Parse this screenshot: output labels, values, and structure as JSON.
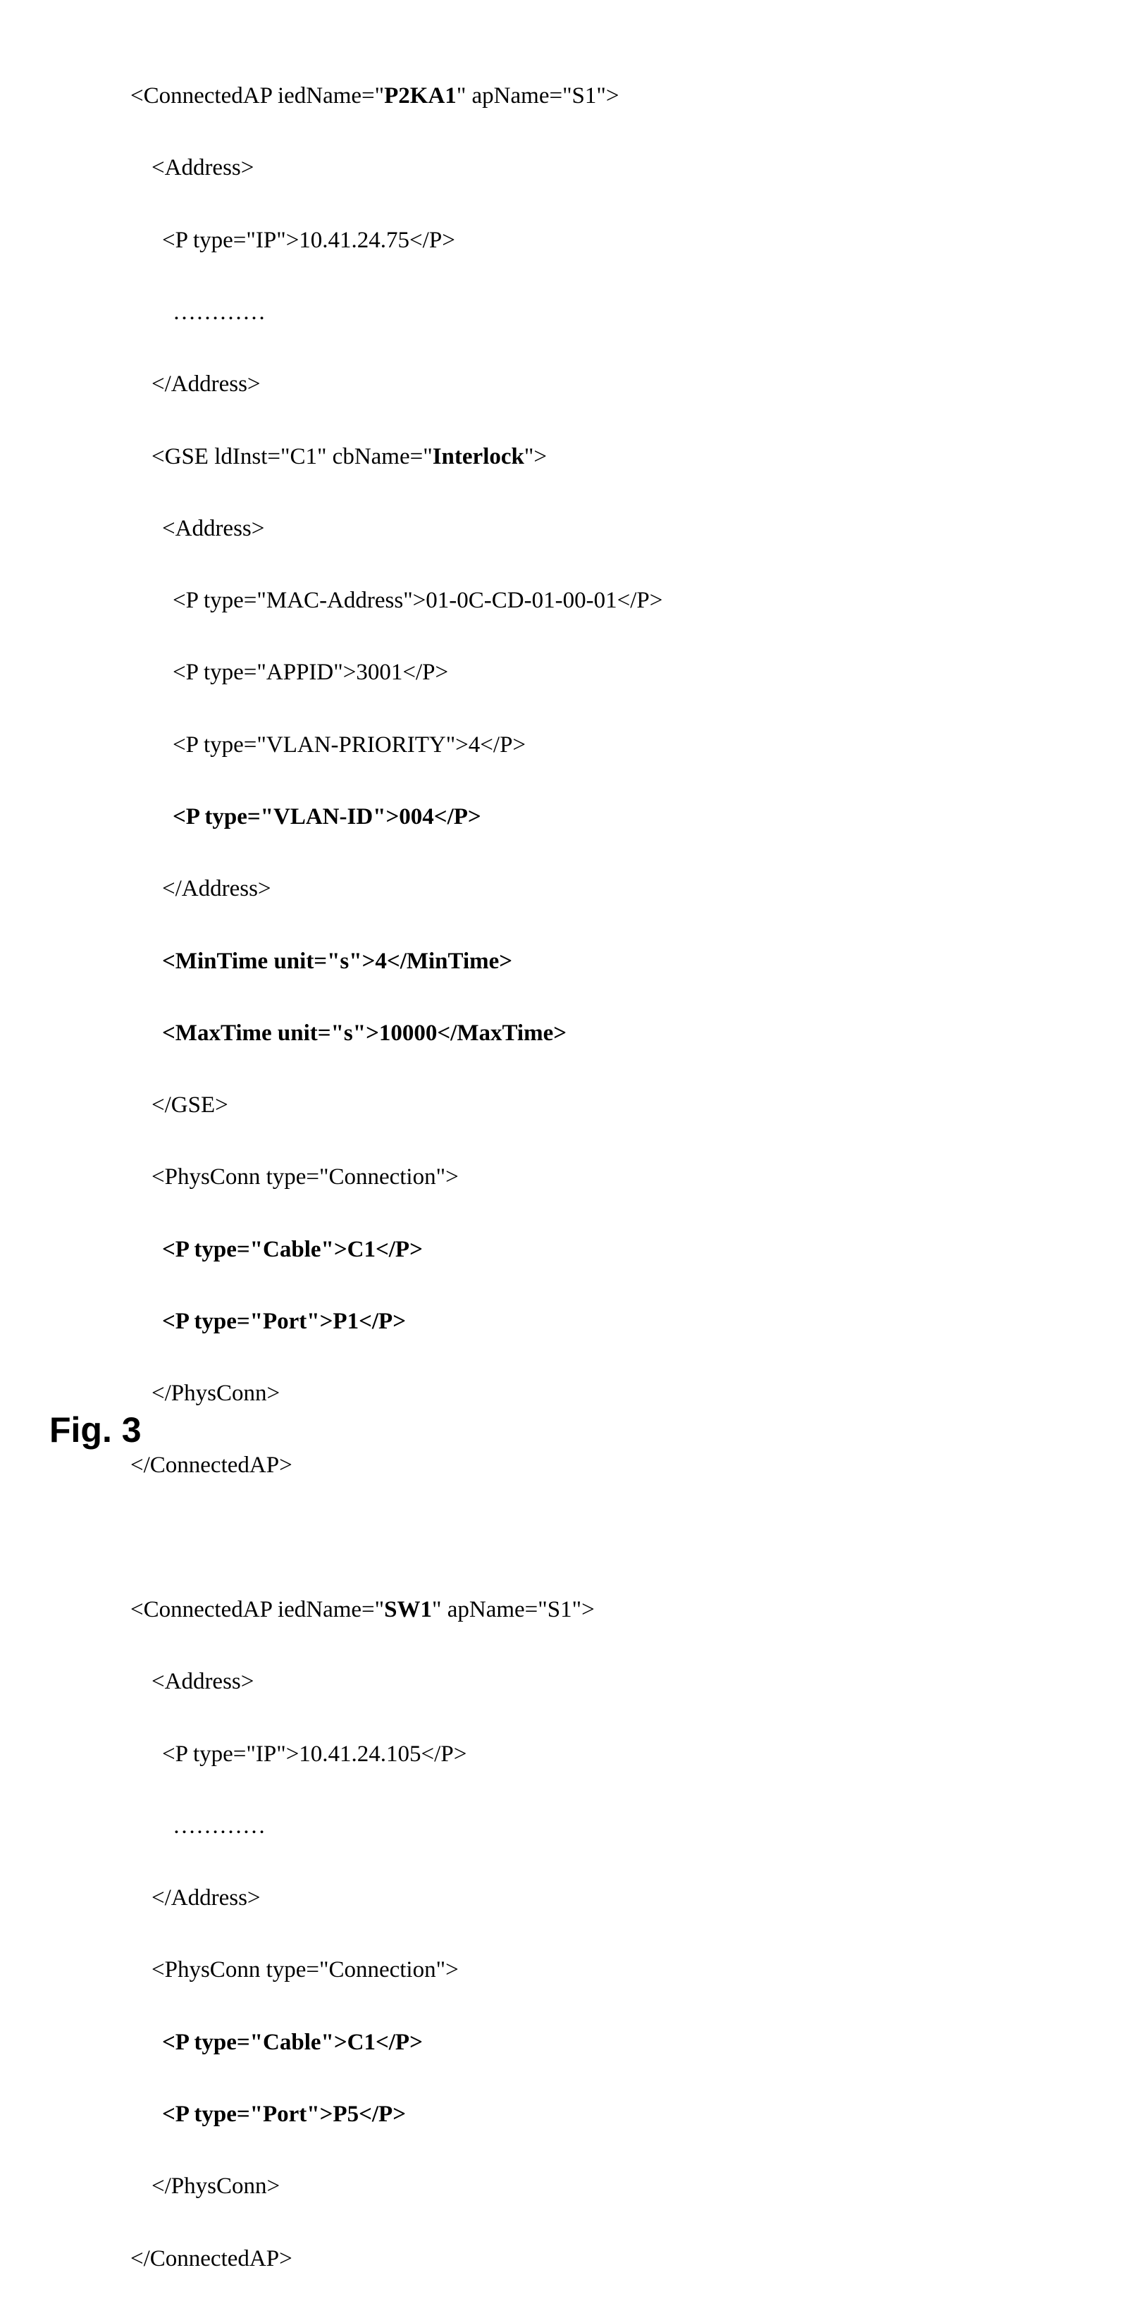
{
  "block1": {
    "line1_pre": "<ConnectedAP iedName=\"",
    "line1_bold": "P2KA1",
    "line1_post": "\" apName=\"S1\">",
    "line2": "<Address>",
    "line3": "<P type=\"IP\">10.41.24.75</P>",
    "dots": "…………",
    "line4": "</Address>",
    "line5_pre": "<GSE ldInst=\"C1\" cbName=\"",
    "line5_bold": "Interlock",
    "line5_post": "\">",
    "line6": "<Address>",
    "line7": "<P type=\"MAC-Address\">01-0C-CD-01-00-01</P>",
    "line8": "<P type=\"APPID\">3001</P>",
    "line9": "<P type=\"VLAN-PRIORITY\">4</P>",
    "line10": "<P type=\"VLAN-ID\">004</P>",
    "line11": "</Address>",
    "line12": "<MinTime unit=\"s\">4</MinTime>",
    "line13": "<MaxTime unit=\"s\">10000</MaxTime>",
    "line14": "</GSE>",
    "line15": "<PhysConn type=\"Connection\">",
    "line16": "<P type=\"Cable\">C1</P>",
    "line17": "<P type=\"Port\">P1</P>",
    "line18": "</PhysConn>",
    "line19": "</ConnectedAP>"
  },
  "block2": {
    "line1_pre": "<ConnectedAP iedName=\"",
    "line1_bold": "SW1",
    "line1_post": "\" apName=\"S1\">",
    "line2": "<Address>",
    "line3": "<P type=\"IP\">10.41.24.105</P>",
    "dots": "…………",
    "line4": "</Address>",
    "line5": "<PhysConn type=\"Connection\">",
    "line6": "<P type=\"Cable\">C1</P>",
    "line7": "<P type=\"Port\">P5</P>",
    "line8": "</PhysConn>",
    "line9": "</ConnectedAP>"
  },
  "figure_label": "Fig. 3"
}
